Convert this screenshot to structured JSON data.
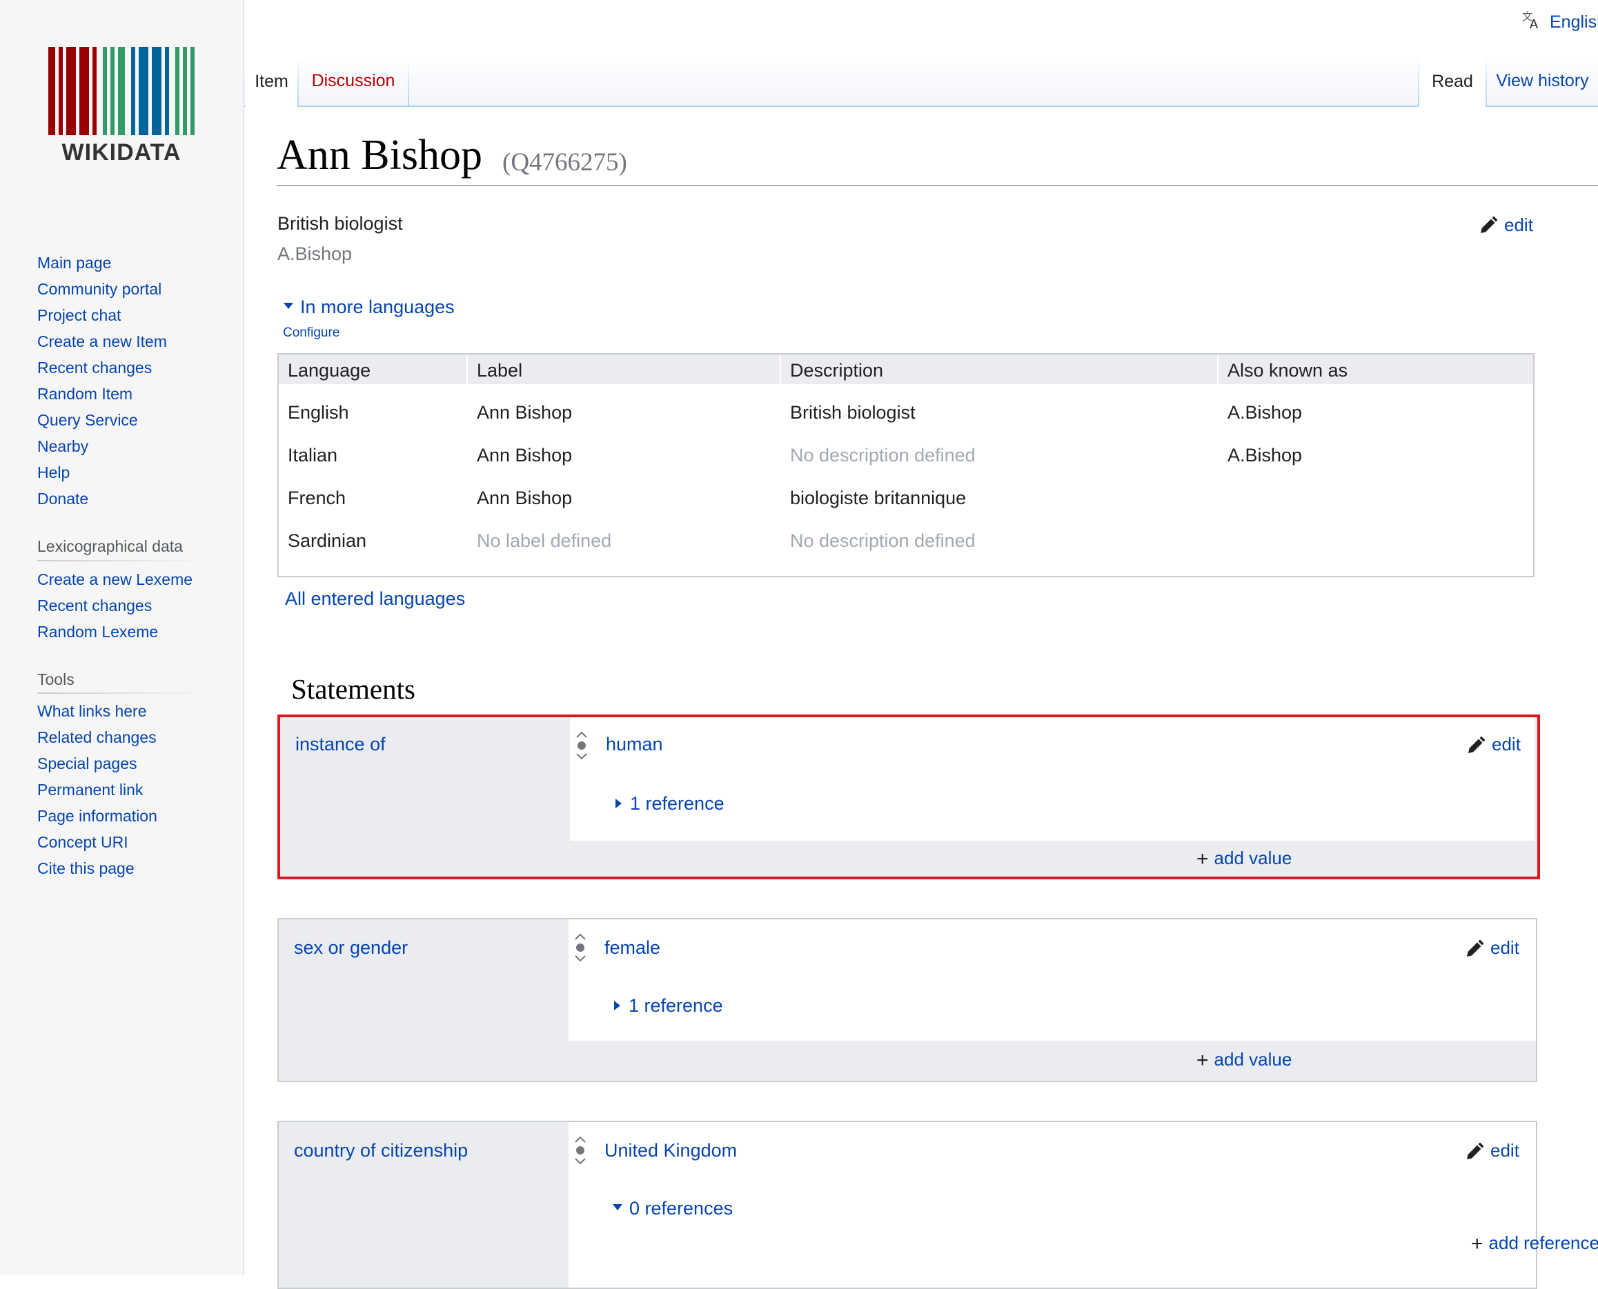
{
  "logo": {
    "wordmark": "WIKIDATA"
  },
  "top": {
    "language_label": "English",
    "language_icon": "translate-icon"
  },
  "tabs": {
    "item": "Item",
    "discussion": "Discussion",
    "read": "Read",
    "view_history": "View history"
  },
  "sidebar": {
    "nav": [
      "Main page",
      "Community portal",
      "Project chat",
      "Create a new Item",
      "Recent changes",
      "Random Item",
      "Query Service",
      "Nearby",
      "Help",
      "Donate"
    ],
    "lexico_heading": "Lexicographical data",
    "lexico": [
      "Create a new Lexeme",
      "Recent changes",
      "Random Lexeme"
    ],
    "tools_heading": "Tools",
    "tools": [
      "What links here",
      "Related changes",
      "Special pages",
      "Permanent link",
      "Page information",
      "Concept URI",
      "Cite this page"
    ]
  },
  "header": {
    "title": "Ann Bishop",
    "qid": "(Q4766275)",
    "description": "British biologist",
    "alias": "A.Bishop",
    "edit": "edit"
  },
  "languages": {
    "toggle": "In more languages",
    "configure": "Configure",
    "columns": [
      "Language",
      "Label",
      "Description",
      "Also known as"
    ],
    "rows": [
      {
        "language": "English",
        "label": "Ann Bishop",
        "description": "British biologist",
        "aliases": "A.Bishop"
      },
      {
        "language": "Italian",
        "label": "Ann Bishop",
        "description": "No description defined",
        "aliases": "A.Bishop"
      },
      {
        "language": "French",
        "label": "Ann Bishop",
        "description": "biologiste britannique",
        "aliases": ""
      },
      {
        "language": "Sardinian",
        "label": "No label defined",
        "description": "No description defined",
        "aliases": ""
      }
    ],
    "all_link": "All entered languages"
  },
  "statements": {
    "heading": "Statements",
    "groups": [
      {
        "property": "instance of",
        "value": "human",
        "edit": "edit",
        "refs": "1 reference",
        "add_value": "add value"
      },
      {
        "property": "sex or gender",
        "value": "female",
        "edit": "edit",
        "refs": "1 reference",
        "add_value": "add value"
      },
      {
        "property": "country of citizenship",
        "value": "United Kingdom",
        "edit": "edit",
        "refs": "0 references",
        "add_reference": "add reference"
      }
    ]
  },
  "colors": {
    "link": "#0645ad",
    "highlight": "#e0161e",
    "group_bg": "#eaecf0"
  }
}
